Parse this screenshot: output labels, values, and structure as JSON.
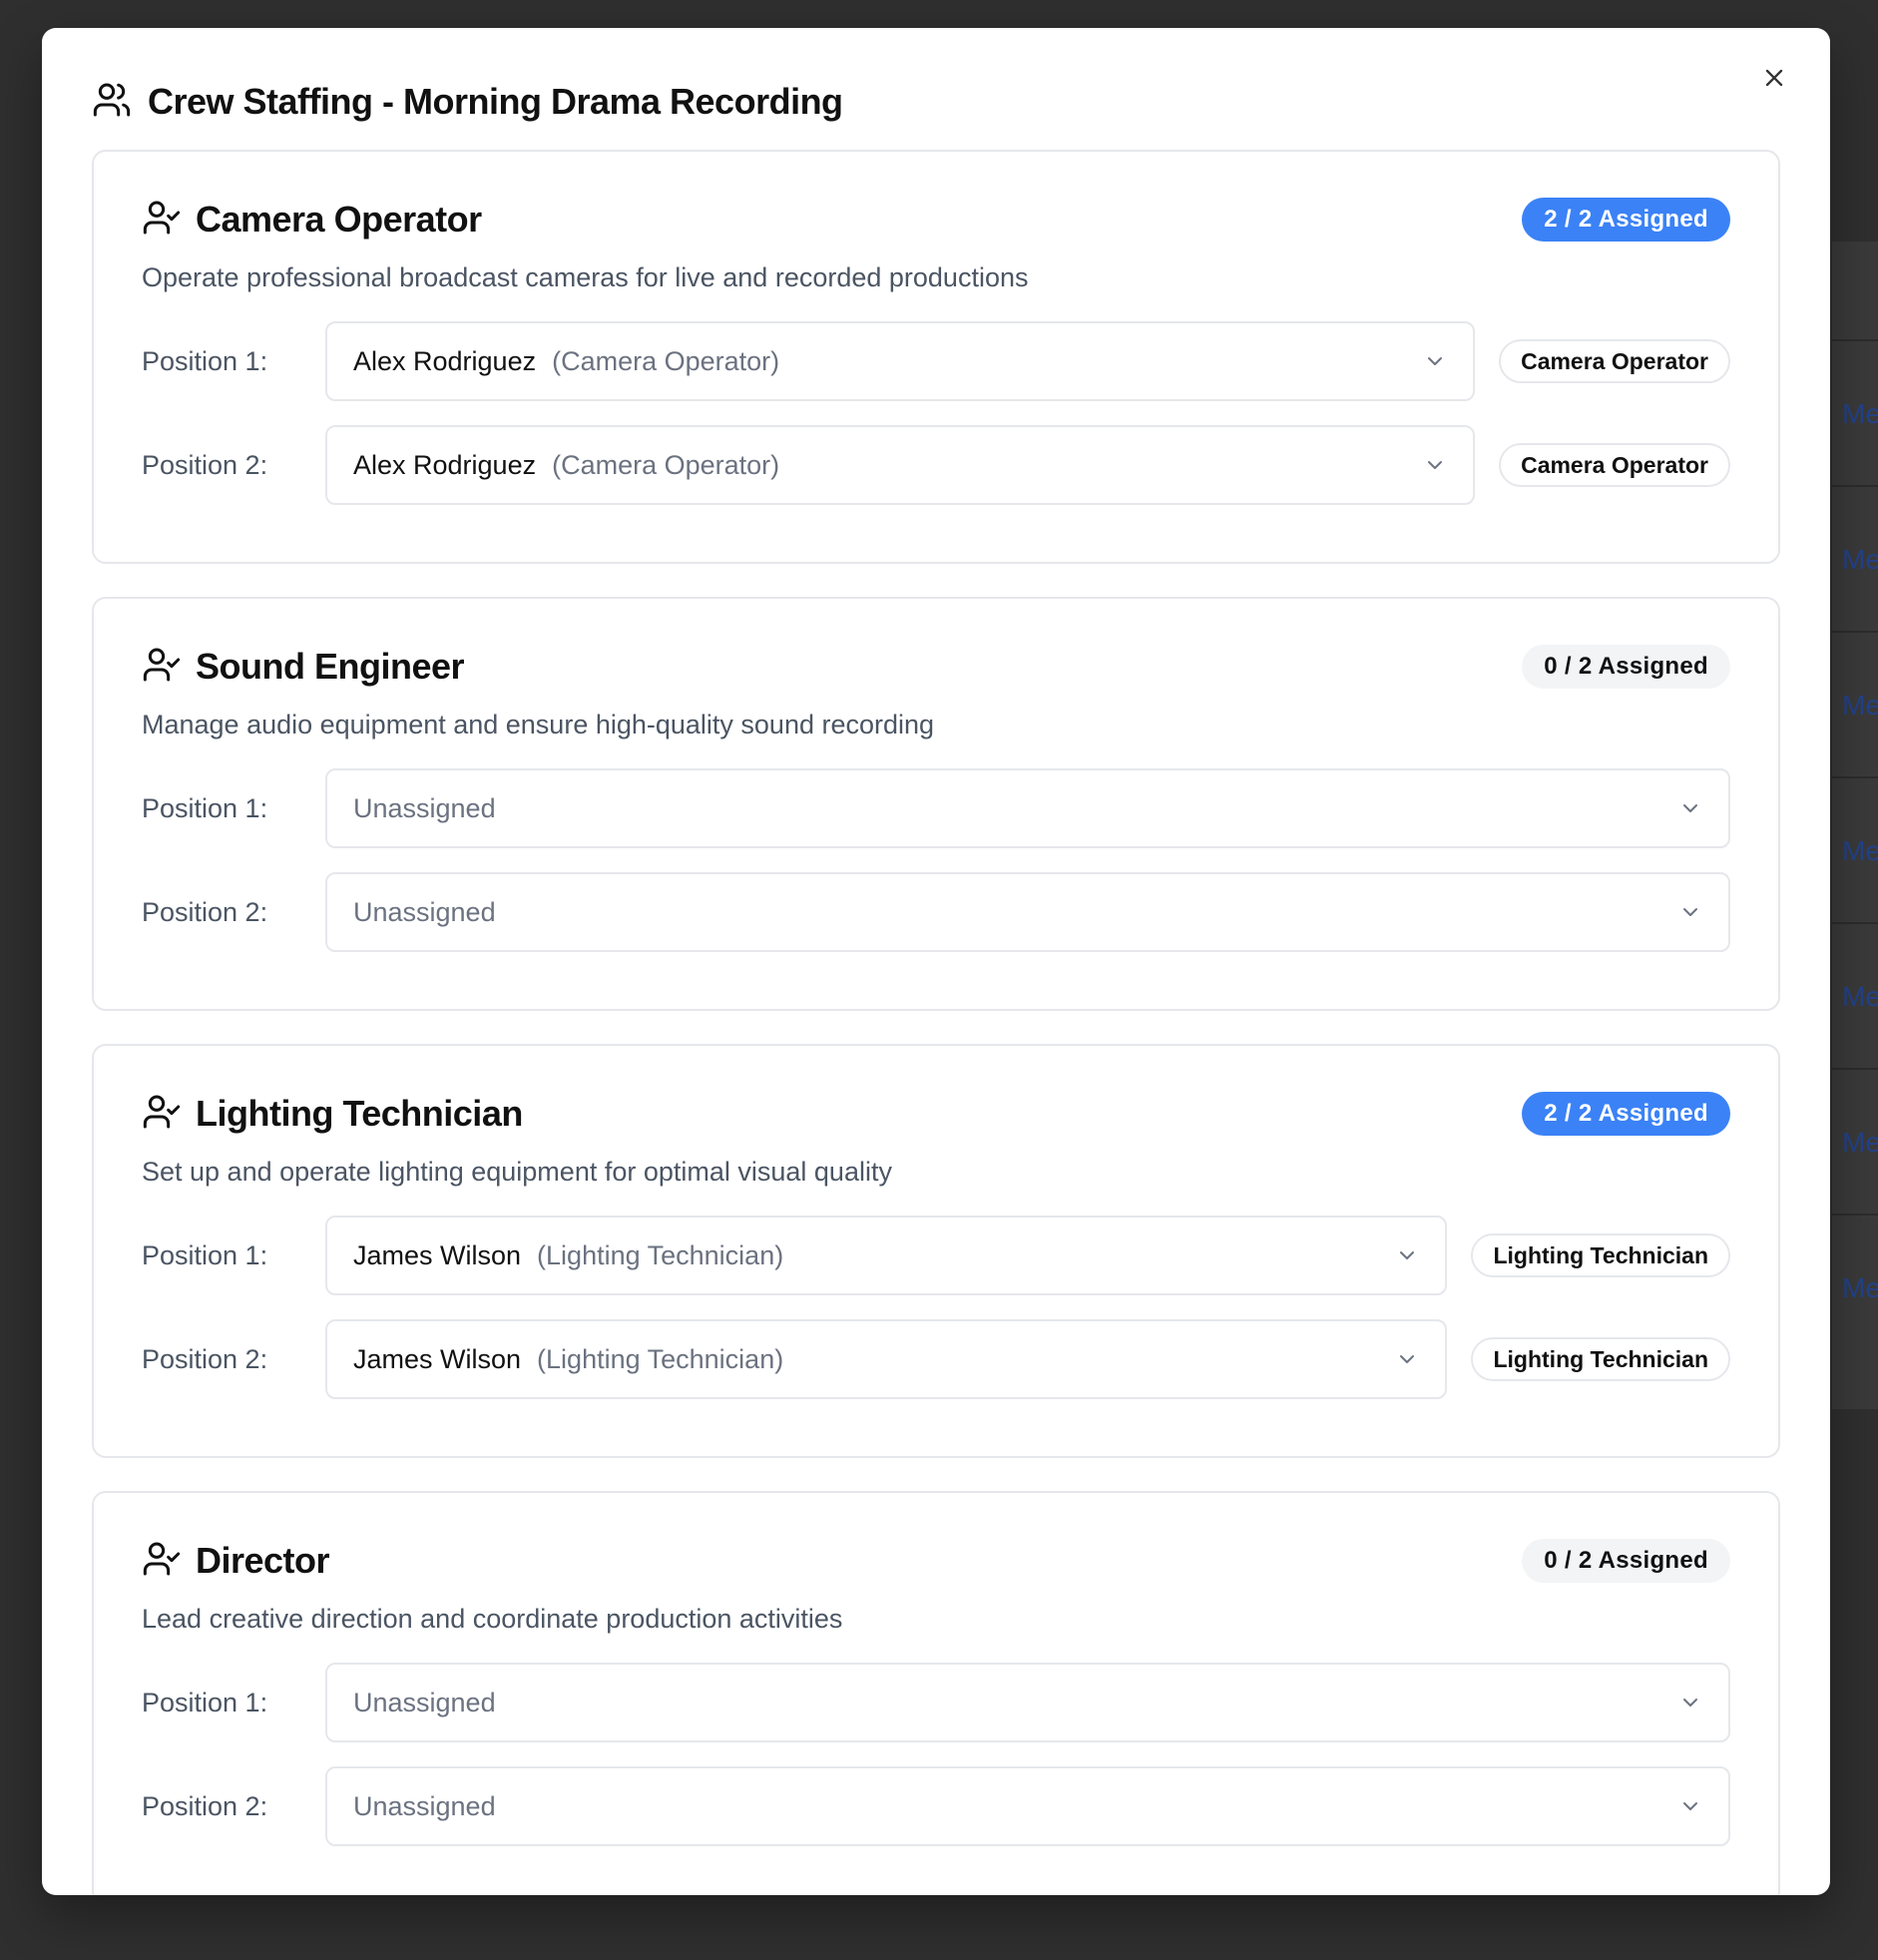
{
  "modal": {
    "title": "Crew Staffing - Morning Drama Recording",
    "header_icon": "users-icon",
    "close_icon": "close-icon"
  },
  "background": {
    "row_text": "Me"
  },
  "roles": [
    {
      "title": "Camera Operator",
      "badge": "2 / 2 Assigned",
      "badge_state": "full",
      "description": "Operate professional broadcast cameras for live and recorded productions",
      "positions": [
        {
          "label": "Position 1:",
          "name": "Alex Rodriguez",
          "role_hint": "(Camera Operator)",
          "tag": "Camera Operator"
        },
        {
          "label": "Position 2:",
          "name": "Alex Rodriguez",
          "role_hint": "(Camera Operator)",
          "tag": "Camera Operator"
        }
      ]
    },
    {
      "title": "Sound Engineer",
      "badge": "0 / 2 Assigned",
      "badge_state": "empty",
      "description": "Manage audio equipment and ensure high-quality sound recording",
      "positions": [
        {
          "label": "Position 1:",
          "placeholder": "Unassigned"
        },
        {
          "label": "Position 2:",
          "placeholder": "Unassigned"
        }
      ]
    },
    {
      "title": "Lighting Technician",
      "badge": "2 / 2 Assigned",
      "badge_state": "full",
      "description": "Set up and operate lighting equipment for optimal visual quality",
      "positions": [
        {
          "label": "Position 1:",
          "name": "James Wilson",
          "role_hint": "(Lighting Technician)",
          "tag": "Lighting Technician"
        },
        {
          "label": "Position 2:",
          "name": "James Wilson",
          "role_hint": "(Lighting Technician)",
          "tag": "Lighting Technician"
        }
      ]
    },
    {
      "title": "Director",
      "badge": "0 / 2 Assigned",
      "badge_state": "empty",
      "description": "Lead creative direction and coordinate production activities",
      "positions": [
        {
          "label": "Position 1:",
          "placeholder": "Unassigned"
        },
        {
          "label": "Position 2:",
          "placeholder": "Unassigned"
        }
      ]
    }
  ]
}
